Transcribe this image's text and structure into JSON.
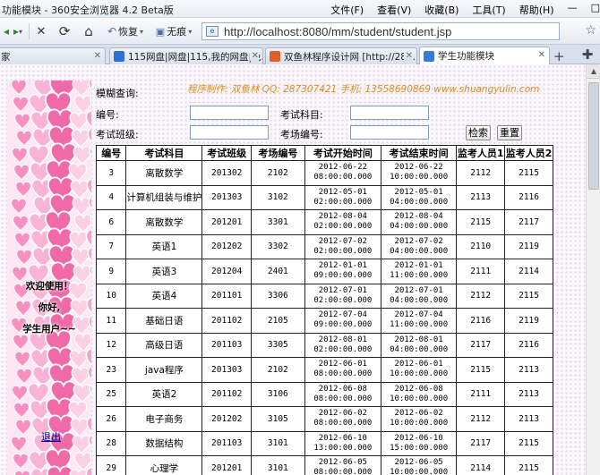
{
  "window": {
    "title": "功能模块 - 360安全浏览器 4.2 Beta版",
    "menus": [
      "文件(F)",
      "查看(V)",
      "收藏(B)",
      "工具(T)",
      "帮助(H)"
    ],
    "controls": [
      "—",
      "□"
    ]
  },
  "toolbar": {
    "back": "◂",
    "forward": "▸",
    "stop": "✕",
    "refresh": "⟳",
    "home": "⌂",
    "restore_label": "恢复",
    "traceless_label": "无痕",
    "address": "http://localhost:8080/mm/student/student.jsp"
  },
  "tabs": [
    {
      "label": "家",
      "icon_color": "#ffffff",
      "active": false
    },
    {
      "label": "115网盘|网盘|115,我的网盘|免...",
      "icon_color": "#2e6fd8",
      "active": false
    },
    {
      "label": "双鱼林程序设计网 [http://287...",
      "icon_color": "#e05f2a",
      "active": false
    },
    {
      "label": "学生功能模块",
      "icon_color": "#3a7bd5",
      "active": true
    }
  ],
  "sidebar": {
    "welcome": "欢迎使用！",
    "hello": "你好,",
    "user": "学生用户~~",
    "logout": "退出"
  },
  "search": {
    "title": "模糊查询:",
    "credit": "程序制作: 双鱼林   QQ: 287307421   手机: 13558690869   www.shuangyulin.com",
    "id_label": "编号:",
    "subject_label": "考试科目:",
    "class_label": "考试班级:",
    "room_label": "考场编号:",
    "search_button": "检索",
    "reset_button": "重置"
  },
  "table": {
    "headers": [
      "编号",
      "考试科目",
      "考试班级",
      "考场编号",
      "考试开始时间",
      "考试结束时间",
      "监考人员1",
      "监考人员2"
    ],
    "rows": [
      [
        "3",
        "离散数学",
        "201302",
        "2102",
        "2012-06-22",
        "08:00:00.000",
        "2012-06-22",
        "10:00:00.000",
        "2112",
        "2115"
      ],
      [
        "4",
        "计算机组装与维护",
        "201303",
        "3102",
        "2012-05-01",
        "02:00:00.000",
        "2012-05-01",
        "04:00:00.000",
        "2113",
        "2116"
      ],
      [
        "6",
        "离散数学",
        "201201",
        "3301",
        "2012-08-04",
        "02:00:00.000",
        "2012-08-04",
        "04:00:00.000",
        "2115",
        "2117"
      ],
      [
        "7",
        "英语1",
        "201202",
        "3302",
        "2012-07-02",
        "02:00:00.000",
        "2012-07-02",
        "04:00:00.000",
        "2110",
        "2119"
      ],
      [
        "9",
        "英语3",
        "201204",
        "2401",
        "2012-01-01",
        "09:00:00.000",
        "2012-01-01",
        "11:00:00.000",
        "2111",
        "2114"
      ],
      [
        "10",
        "英语4",
        "201101",
        "3306",
        "2012-07-01",
        "02:00:00.000",
        "2012-07-01",
        "04:00:00.000",
        "2112",
        "2115"
      ],
      [
        "11",
        "基础日语",
        "201102",
        "2105",
        "2012-07-04",
        "09:00:00.000",
        "2012-07-04",
        "11:00:00.000",
        "2116",
        "2119"
      ],
      [
        "12",
        "高级日语",
        "201103",
        "3305",
        "2012-08-01",
        "02:00:00.000",
        "2012-08-01",
        "04:00:00.000",
        "2117",
        "2116"
      ],
      [
        "23",
        "java程序",
        "201303",
        "2102",
        "2012-06-01",
        "08:00:00.000",
        "2012-06-01",
        "10:00:00.000",
        "2115",
        "2113"
      ],
      [
        "25",
        "英语2",
        "201102",
        "3106",
        "2012-06-08",
        "08:00:00.000",
        "2012-06-08",
        "10:00:00.000",
        "2111",
        "2113"
      ],
      [
        "26",
        "电子商务",
        "201202",
        "3105",
        "2012-06-02",
        "08:00:00.000",
        "2012-06-02",
        "10:00:00.000",
        "2112",
        "2113"
      ],
      [
        "28",
        "数据结构",
        "201103",
        "3101",
        "2012-06-10",
        "13:00:00.000",
        "2012-06-10",
        "15:00:00.000",
        "2117",
        "2115"
      ],
      [
        "29",
        "心理学",
        "201201",
        "3101",
        "2012-06-05",
        "08:00:00.000",
        "2012-06-05",
        "10:00:00.000",
        "2114",
        "2115"
      ]
    ]
  }
}
